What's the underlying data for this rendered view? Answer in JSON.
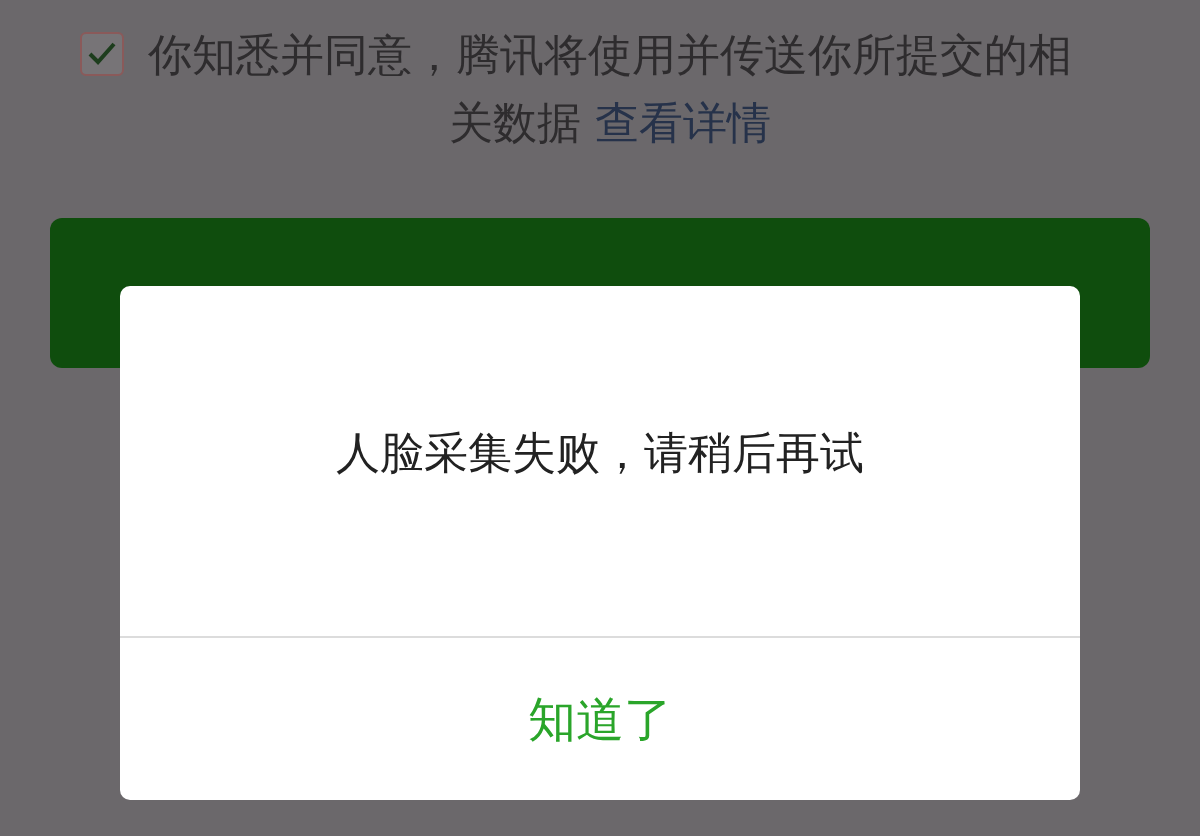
{
  "agreement": {
    "checked": true,
    "text": "你知悉并同意，腾讯将使用并传送你所提交的相关数据",
    "link": "查看详情"
  },
  "dialog": {
    "message": "人脸采集失败，请稍后再试",
    "button": "知道了"
  }
}
